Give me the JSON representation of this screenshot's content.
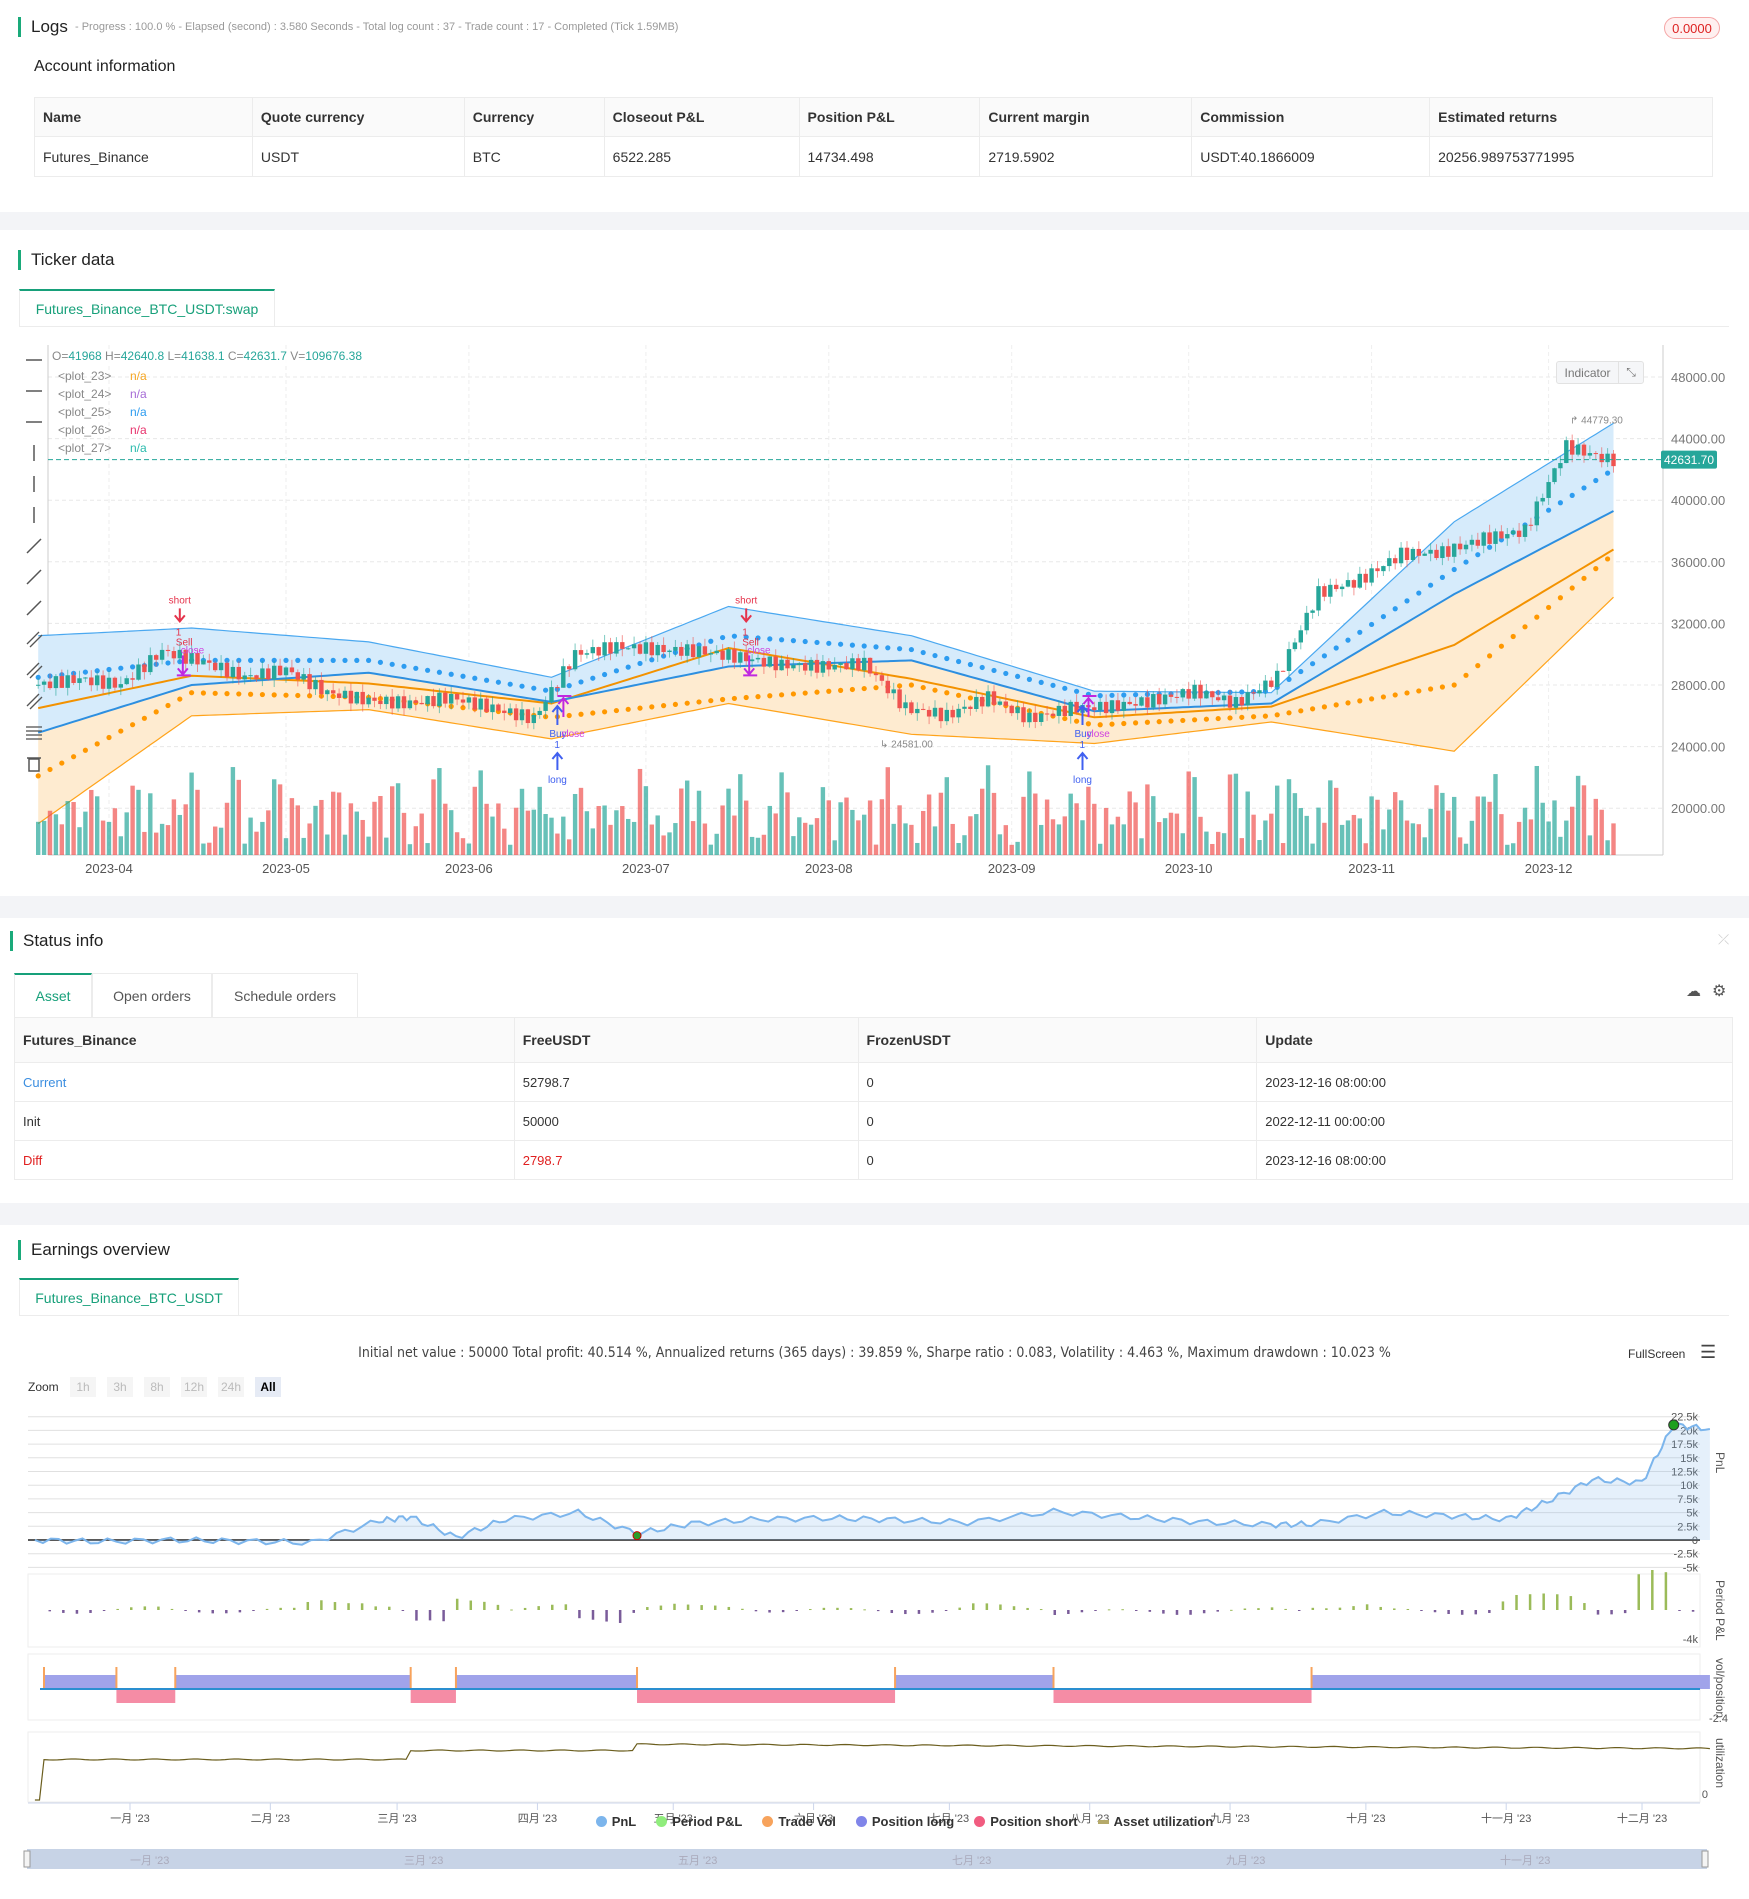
{
  "logs": {
    "title": "Logs",
    "progress": "- Progress : 100.0 % - Elapsed (second) : 3.580  Seconds - Total log count : 37 - Trade count : 17 - Completed (Tick 1.59MB)",
    "badge": "0.0000"
  },
  "account": {
    "title": "Account information",
    "headers": [
      "Name",
      "Quote currency",
      "Currency",
      "Closeout P&L",
      "Position P&L",
      "Current margin",
      "Commission",
      "Estimated returns"
    ],
    "row": [
      "Futures_Binance",
      "USDT",
      "BTC",
      "6522.285",
      "14734.498",
      "2719.5902",
      "USDT:40.1866009",
      "20256.989753771995"
    ]
  },
  "ticker": {
    "title": "Ticker data",
    "tab": "Futures_Binance_BTC_USDT:swap",
    "ohlc": {
      "o_label": "O=",
      "o": "41968",
      "h_label": " H=",
      "h": "42640.8",
      "l_label": " L=",
      "l": "41638.1",
      "c_label": " C=",
      "c": "42631.7",
      "v_label": " V=",
      "v": "109676.38"
    },
    "plots": [
      {
        "name": "<plot_23>",
        "value": "n/a",
        "color": "#f5a623"
      },
      {
        "name": "<plot_24>",
        "value": "n/a",
        "color": "#a66bd6"
      },
      {
        "name": "<plot_25>",
        "value": "n/a",
        "color": "#2d9cf0"
      },
      {
        "name": "<plot_26>",
        "value": "n/a",
        "color": "#e8336d"
      },
      {
        "name": "<plot_27>",
        "value": "n/a",
        "color": "#2bbbad"
      }
    ],
    "indicator_btn": "Indicator",
    "current_price": "42631.70",
    "max_label": "44779.30",
    "min_label": "24581.00",
    "colors": {
      "up": "#26a69a",
      "down": "#ef5350",
      "band_blue": "#2d9cf0",
      "band_orange": "#ff9800"
    }
  },
  "chart_data": [
    {
      "type": "candlestick",
      "name": "price",
      "y_ticks": [
        "48000.00",
        "44000.00",
        "40000.00",
        "36000.00",
        "32000.00",
        "28000.00",
        "24000.00",
        "20000.00"
      ],
      "x_ticks": [
        "2023-04",
        "2023-05",
        "2023-06",
        "2023-07",
        "2023-08",
        "2023-09",
        "2023-10",
        "2023-11",
        "2023-12"
      ],
      "ylim": [
        18000,
        50000
      ],
      "weekly_dates": [
        "2023-03-20",
        "2023-03-27",
        "2023-04-03",
        "2023-04-10",
        "2023-04-17",
        "2023-04-24",
        "2023-05-01",
        "2023-05-08",
        "2023-05-15",
        "2023-05-22",
        "2023-05-29",
        "2023-06-05",
        "2023-06-12",
        "2023-06-19",
        "2023-06-26",
        "2023-07-03",
        "2023-07-10",
        "2023-07-17",
        "2023-07-24",
        "2023-07-31",
        "2023-08-07",
        "2023-08-14",
        "2023-08-21",
        "2023-08-28",
        "2023-09-04",
        "2023-09-11",
        "2023-09-18",
        "2023-09-25",
        "2023-10-02",
        "2023-10-09",
        "2023-10-16",
        "2023-10-23",
        "2023-10-30",
        "2023-11-06",
        "2023-11-13",
        "2023-11-20",
        "2023-11-27",
        "2023-12-04",
        "2023-12-11"
      ],
      "weekly_close": [
        28000,
        28400,
        28000,
        30200,
        29500,
        28500,
        29000,
        27500,
        27000,
        26800,
        27200,
        26500,
        25800,
        30000,
        30500,
        30300,
        30200,
        29800,
        29300,
        29200,
        29400,
        26500,
        26000,
        27200,
        25800,
        26500,
        26600,
        27000,
        27600,
        26800,
        28500,
        34000,
        34800,
        36500,
        36600,
        37500,
        38000,
        43500,
        42631.7
      ],
      "band_dates": [
        "2023-03-20",
        "2023-04-15",
        "2023-05-15",
        "2023-06-15",
        "2023-07-15",
        "2023-08-15",
        "2023-09-15",
        "2023-10-15",
        "2023-11-15",
        "2023-12-12"
      ],
      "upper_band": [
        31200,
        31700,
        30800,
        28500,
        33100,
        31200,
        27600,
        27500,
        38600,
        45000
      ],
      "middle_line": [
        24900,
        28000,
        28800,
        26900,
        29200,
        29600,
        26300,
        26800,
        33900,
        39300
      ],
      "upper_dots": [
        28500,
        29600,
        29600,
        27600,
        31200,
        30300,
        27300,
        27600,
        35500,
        42000
      ],
      "orange_line": [
        26500,
        28600,
        28100,
        26800,
        30400,
        28400,
        25900,
        26600,
        30600,
        36800
      ],
      "lower_dots": [
        22100,
        27500,
        27200,
        25900,
        27100,
        28000,
        25400,
        26000,
        28000,
        36500
      ],
      "lower_band": [
        19000,
        26000,
        26400,
        24500,
        26800,
        24800,
        24200,
        25600,
        23700,
        33700
      ],
      "markers": [
        {
          "date": "2023-04-13",
          "side": "short",
          "labels": [
            "short",
            "1",
            "Sell",
            "close"
          ]
        },
        {
          "date": "2023-06-16",
          "side": "long",
          "labels": [
            "Buy",
            "1",
            "long",
            "close"
          ]
        },
        {
          "date": "2023-07-18",
          "side": "short",
          "labels": [
            "short",
            "1",
            "Sell",
            "close"
          ]
        },
        {
          "date": "2023-09-13",
          "side": "long",
          "labels": [
            "Buy",
            "1",
            "long",
            "close"
          ]
        }
      ]
    },
    {
      "type": "area",
      "name": "PnL",
      "y_ticks": [
        "22.5k",
        "20k",
        "17.5k",
        "15k",
        "12.5k",
        "10k",
        "7.5k",
        "5k",
        "2.5k",
        "0",
        "-2.5k",
        "-5k"
      ],
      "x_ticks": [
        "一月 '23",
        "二月 '23",
        "三月 '23",
        "四月 '23",
        "五月 '23",
        "六月 '23",
        "七月 '23",
        "八月 '23",
        "九月 '23",
        "十月 '23",
        "十一月 '23",
        "十二月 '23"
      ],
      "x": [
        "2022-12-11",
        "2022-12-25",
        "2023-01-10",
        "2023-01-25",
        "2023-02-10",
        "2023-02-25",
        "2023-03-04",
        "2023-03-14",
        "2023-03-25",
        "2023-04-10",
        "2023-04-23",
        "2023-05-05",
        "2023-05-20",
        "2023-06-05",
        "2023-06-19",
        "2023-07-05",
        "2023-07-24",
        "2023-08-10",
        "2023-08-25",
        "2023-09-10",
        "2023-09-19",
        "2023-10-05",
        "2023-10-20",
        "2023-11-01",
        "2023-11-10",
        "2023-11-20",
        "2023-12-01",
        "2023-12-08",
        "2023-12-16"
      ],
      "values": [
        0,
        -300,
        0,
        -200,
        -500,
        3500,
        4200,
        500,
        3800,
        5000,
        1200,
        3000,
        3800,
        4000,
        3700,
        3200,
        5200,
        4200,
        3300,
        2800,
        2900,
        5000,
        4400,
        3800,
        7000,
        11000,
        10500,
        21000,
        20256
      ]
    },
    {
      "type": "segments",
      "name": "vol/position",
      "y_min_label": "-2.4",
      "period_pnl_min_label": "-4k",
      "utilization_min_label": "0",
      "positions": [
        [
          "2022-12-13",
          "2022-12-29",
          "long"
        ],
        [
          "2022-12-29",
          "2023-01-11",
          "short"
        ],
        [
          "2023-01-11",
          "2023-03-04",
          "long"
        ],
        [
          "2023-03-04",
          "2023-03-14",
          "short"
        ],
        [
          "2023-03-14",
          "2023-04-23",
          "long"
        ],
        [
          "2023-04-23",
          "2023-06-19",
          "short"
        ],
        [
          "2023-06-19",
          "2023-07-24",
          "long"
        ],
        [
          "2023-07-24",
          "2023-09-19",
          "short"
        ],
        [
          "2023-09-19",
          "2023-12-16",
          "long"
        ]
      ]
    }
  ],
  "status": {
    "title": "Status info",
    "tabs": [
      "Asset",
      "Open orders",
      "Schedule orders"
    ],
    "headers": [
      "Futures_Binance",
      "FreeUSDT",
      "FrozenUSDT",
      "Update"
    ],
    "rows": [
      [
        "Current",
        "52798.7",
        "0",
        "2023-12-16 08:00:00"
      ],
      [
        "Init",
        "50000",
        "0",
        "2022-12-11 00:00:00"
      ],
      [
        "Diff",
        "2798.7",
        "0",
        "2023-12-16 08:00:00"
      ]
    ]
  },
  "earnings": {
    "title": "Earnings overview",
    "tab": "Futures_Binance_BTC_USDT",
    "summary": "Initial net value : 50000 Total profit: 40.514 %, Annualized returns (365 days) : 39.859 %, Sharpe ratio : 0.083, Volatility : 4.463 %, Maximum drawdown : 10.023 %",
    "fullscreen": "FullScreen",
    "zoom_label": "Zoom",
    "zoom_opts": [
      "1h",
      "3h",
      "8h",
      "12h",
      "24h",
      "All"
    ],
    "axis_titles": [
      "PnL",
      "Period P&L",
      "vol/position",
      "utilization"
    ],
    "legend": [
      {
        "label": "PnL",
        "color": "#7cb5ec"
      },
      {
        "label": "Period P&L",
        "color": "#90ed7d"
      },
      {
        "label": "Trade Vol",
        "color": "#f7a35c"
      },
      {
        "label": "Position long",
        "color": "#8085e9"
      },
      {
        "label": "Position short",
        "color": "#f15c80"
      },
      {
        "label": "Asset utilization",
        "color": "#b5a96a"
      }
    ],
    "nav_ticks": [
      "一月 '23",
      "三月 '23",
      "五月 '23",
      "七月 '23",
      "九月 '23",
      "十一月 '23"
    ]
  }
}
